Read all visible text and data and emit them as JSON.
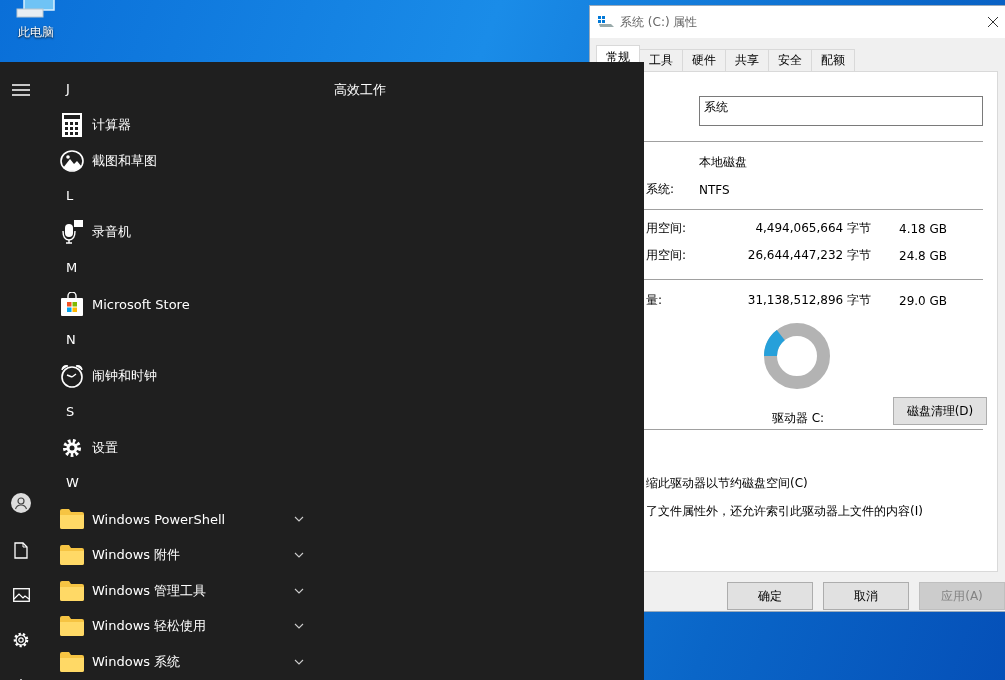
{
  "desktop": {
    "icons": [
      {
        "label": "此电脑"
      }
    ]
  },
  "start_menu": {
    "apps": [
      {
        "kind": "letter",
        "text": "J"
      },
      {
        "kind": "app",
        "name": "计算器"
      },
      {
        "kind": "app",
        "name": "截图和草图"
      },
      {
        "kind": "letter",
        "text": "L"
      },
      {
        "kind": "app",
        "name": "录音机"
      },
      {
        "kind": "letter",
        "text": "M"
      },
      {
        "kind": "app",
        "name": "Microsoft Store"
      },
      {
        "kind": "letter",
        "text": "N"
      },
      {
        "kind": "app",
        "name": "闹钟和时钟"
      },
      {
        "kind": "letter",
        "text": "S"
      },
      {
        "kind": "app",
        "name": "设置"
      },
      {
        "kind": "letter",
        "text": "W"
      },
      {
        "kind": "folder",
        "name": "Windows PowerShell",
        "expanded": false
      },
      {
        "kind": "folder",
        "name": "Windows 附件",
        "expanded": false
      },
      {
        "kind": "folder",
        "name": "Windows 管理工具",
        "expanded": false
      },
      {
        "kind": "folder",
        "name": "Windows 轻松使用",
        "expanded": false
      },
      {
        "kind": "folder",
        "name": "Windows 系统",
        "expanded": false
      }
    ],
    "tiles_header": "高效工作"
  },
  "dialog": {
    "title": "系统 (C:) 属性",
    "tabs": [
      {
        "label": "常规",
        "selected": true
      },
      {
        "label": "工具",
        "selected": false
      },
      {
        "label": "硬件",
        "selected": false
      },
      {
        "label": "共享",
        "selected": false
      },
      {
        "label": "安全",
        "selected": false
      },
      {
        "label": "配额",
        "selected": false
      }
    ],
    "name_field": {
      "value": "系统"
    },
    "type_value": "本地磁盘",
    "filesystem": {
      "label": "系统:",
      "value": "NTFS"
    },
    "space": [
      {
        "label": "用空间:",
        "bytes": "4,494,065,664 字节",
        "size": "4.18 GB"
      },
      {
        "label": "用空间:",
        "bytes": "26,644,447,232 字节",
        "size": "24.8 GB"
      }
    ],
    "capacity": {
      "label": "量:",
      "bytes": "31,138,512,896 字节",
      "size": "29.0 GB"
    },
    "usage": {
      "level": 0.144
    },
    "drive_label": "驱动器 C:",
    "cleanup_button": "磁盘清理(D)",
    "options": [
      {
        "label": "缩此驱动器以节约磁盘空间(C)"
      },
      {
        "label": "了文件属性外，还允许索引此驱动器上文件的内容(I)"
      }
    ],
    "buttons": [
      {
        "label": "确定",
        "disabled": false
      },
      {
        "label": "取消",
        "disabled": false
      },
      {
        "label": "应用(A)",
        "disabled": true
      }
    ]
  }
}
